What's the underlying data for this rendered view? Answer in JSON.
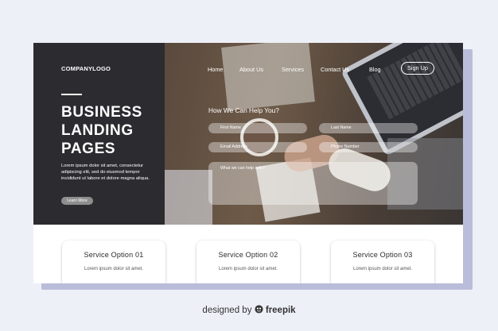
{
  "brand": {
    "logo": "COMPANYLOGO"
  },
  "hero": {
    "headline": [
      "BUSINESS",
      "LANDING",
      "PAGES"
    ],
    "body": "Lorem ipsum dolor sit amet, consectetur adipiscing elit, sed do eiusmod tempor incididunt ut labore et dolore magna aliqua.",
    "cta_label": "Learn More"
  },
  "nav": {
    "items": [
      "Home",
      "About Us",
      "Services",
      "Contact Us",
      "Blog"
    ],
    "signup_label": "Sign Up"
  },
  "form": {
    "title": "How We Can Help You?",
    "first_name_placeholder": "First Name",
    "last_name_placeholder": "Last Name",
    "email_placeholder": "Email Address",
    "phone_placeholder": "Phone Number",
    "message_placeholder": "What we can help with?"
  },
  "services": [
    {
      "title": "Service Option 01",
      "text": "Lorem ipsum dolor sit amet."
    },
    {
      "title": "Service Option 02",
      "text": "Lorem ipsum dolor sit amet."
    },
    {
      "title": "Service Option 03",
      "text": "Lorem ipsum dolor sit amet."
    }
  ],
  "footer": {
    "prefix": "designed by",
    "brand": "freepik"
  },
  "colors": {
    "sidebar": "#2c2c30",
    "background": "#eef0f8",
    "accent_shadow": "#b9bdd9"
  }
}
